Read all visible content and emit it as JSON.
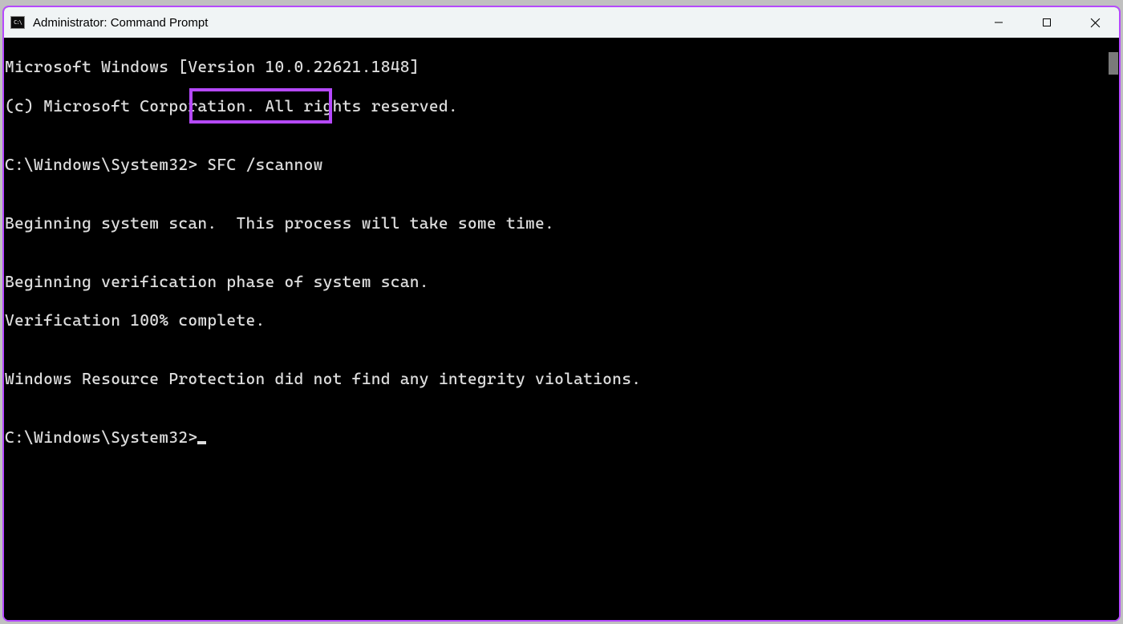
{
  "window": {
    "title": "Administrator: Command Prompt",
    "icon_label": "C:\\"
  },
  "terminal": {
    "lines": {
      "l0": "Microsoft Windows [Version 10.0.22621.1848]",
      "l1": "(c) Microsoft Corporation. All rights reserved.",
      "l2": "",
      "l3_prompt": "C:\\Windows\\System32>",
      "l3_cmd": " SFC /scannow ",
      "l4": "",
      "l5": "Beginning system scan.  This process will take some time.",
      "l6": "",
      "l7": "Beginning verification phase of system scan.",
      "l8": "Verification 100% complete.",
      "l9": "",
      "l10": "Windows Resource Protection did not find any integrity violations.",
      "l11": "",
      "l12": "C:\\Windows\\System32>"
    }
  },
  "annotation": {
    "highlight_color": "#b649ff"
  }
}
